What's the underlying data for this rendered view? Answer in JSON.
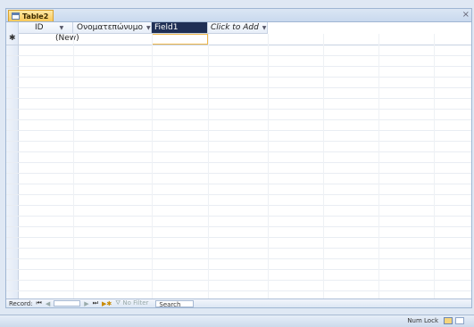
{
  "tab": {
    "label": "Table2",
    "close": "×"
  },
  "columns": [
    {
      "label": "ID",
      "has_dropdown": true
    },
    {
      "label": "Ονοματεπώνυμο",
      "has_dropdown": true
    },
    {
      "label": "Field1",
      "has_dropdown": false
    },
    {
      "label": "Click to Add",
      "has_dropdown": true
    }
  ],
  "new_row": {
    "marker": "✱",
    "id_value": "(New)"
  },
  "nav": {
    "record_label": "Record:",
    "first": "⏮",
    "prev": "◀",
    "next": "▶",
    "last": "⏭",
    "new": "▶✱",
    "filter": "No Filter",
    "search": "Search"
  },
  "status": {
    "numlock": "Num Lock"
  },
  "colors": {
    "field_selected": "#1f2f55",
    "tab_accent": "#f8c85a"
  }
}
